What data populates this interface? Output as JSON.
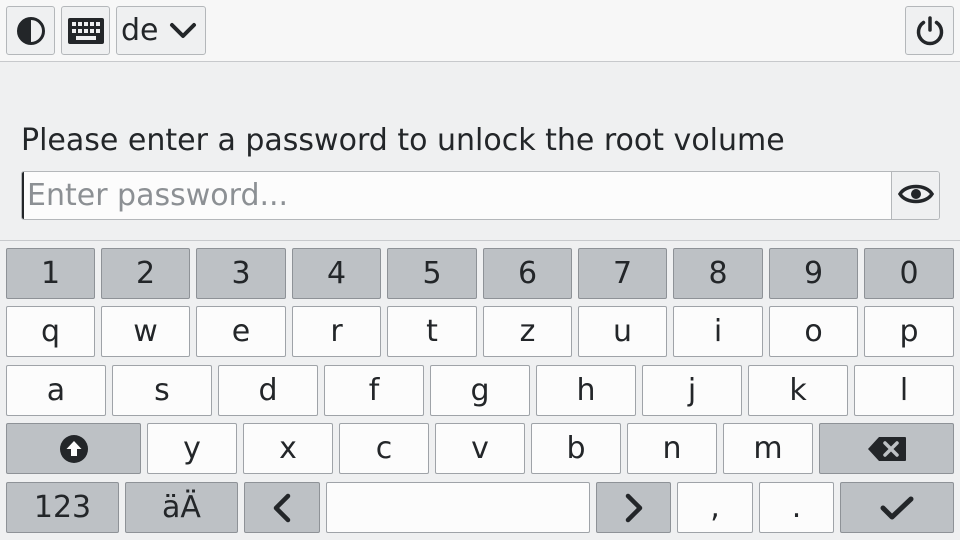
{
  "topbar": {
    "contrast_icon": "contrast-icon",
    "keyboard_icon": "keyboard-icon",
    "layout_label": "de",
    "layout_chevron_icon": "chevron-down-icon",
    "power_icon": "power-icon"
  },
  "prompt": {
    "text": "Please enter a password to unlock the root volume"
  },
  "password": {
    "value": "",
    "placeholder": "Enter password...",
    "reveal_icon": "eye-icon"
  },
  "keyboard": {
    "numbers": [
      "1",
      "2",
      "3",
      "4",
      "5",
      "6",
      "7",
      "8",
      "9",
      "0"
    ],
    "row1": [
      "q",
      "w",
      "e",
      "r",
      "t",
      "z",
      "u",
      "i",
      "o",
      "p"
    ],
    "row2": [
      "a",
      "s",
      "d",
      "f",
      "g",
      "h",
      "j",
      "k",
      "l"
    ],
    "row3": [
      "y",
      "x",
      "c",
      "v",
      "b",
      "n",
      "m"
    ],
    "shift_icon": "shift-icon",
    "backspace_icon": "backspace-icon",
    "mode_label": "123",
    "umlaut_label": "äÄ",
    "left_icon": "chevron-left-icon",
    "right_icon": "chevron-right-icon",
    "comma": ",",
    "period": ".",
    "enter_icon": "check-icon"
  },
  "colors": {
    "background": "#eff0f1",
    "key_light": "#fcfcfc",
    "key_dark": "#bdc1c5",
    "text": "#232629"
  }
}
